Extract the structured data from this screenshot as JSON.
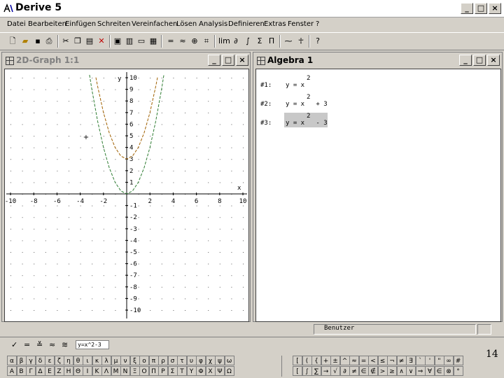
{
  "window": {
    "title": "Derive 5"
  },
  "menu": [
    "Datei",
    "Bearbeiten",
    "Einfügen",
    "Schreiten",
    "Vereinfachen",
    "Lösen",
    "Analysis",
    "Definieren",
    "Extras",
    "Fenster",
    "?"
  ],
  "graph_window": {
    "title": "2D-Graph 1:1",
    "y_label": "y",
    "x_label": "x",
    "x_ticks": [
      "-10",
      "-8",
      "-6",
      "-4",
      "-2",
      "2",
      "4",
      "6",
      "8",
      "10"
    ],
    "y_ticks": [
      "10",
      "9",
      "8",
      "7",
      "6",
      "5",
      "4",
      "3",
      "2",
      "1",
      "-1",
      "-2",
      "-3",
      "-4",
      "-5",
      "-6",
      "-7",
      "-8",
      "-9",
      "-10"
    ],
    "cross_marker": "+",
    "chart_data": {
      "type": "line",
      "xlim": [
        -10,
        10
      ],
      "ylim": [
        -10,
        10
      ],
      "grid": "dots",
      "series": [
        {
          "x": [
            -3.2,
            -3,
            -2.5,
            -2,
            -1.5,
            -1,
            -0.5,
            0,
            0.5,
            1,
            1.5,
            2,
            2.5,
            3,
            3.2
          ],
          "y": [
            10.24,
            9,
            6.25,
            4,
            2.25,
            1,
            0.25,
            0,
            0.25,
            1,
            2.25,
            4,
            6.25,
            9,
            10.24
          ],
          "color": "#2e7d32"
        },
        {
          "x": [
            -2.65,
            -2.5,
            -2,
            -1.5,
            -1,
            -0.5,
            0,
            0.5,
            1,
            1.5,
            2,
            2.5,
            2.65
          ],
          "y": [
            10.02,
            9.25,
            7,
            5.25,
            4,
            3.25,
            3,
            3.25,
            4,
            5.25,
            7,
            9.25,
            10.02
          ],
          "color": "#a06000"
        }
      ]
    }
  },
  "algebra_window": {
    "title": "Algebra 1",
    "expressions": [
      {
        "label": "#1:",
        "text": "y = x",
        "exp": "2",
        "tail": ""
      },
      {
        "label": "#2:",
        "text": "y = x",
        "exp": "2",
        "tail": " + 3"
      },
      {
        "label": "#3:",
        "text": "y = x",
        "exp": "2",
        "tail": " - 3"
      }
    ]
  },
  "status": {
    "text": "Benutzer"
  },
  "entry": {
    "value": "y=x^2-3"
  },
  "greek_lower": [
    "α",
    "β",
    "γ",
    "δ",
    "ε",
    "ζ",
    "η",
    "θ",
    "ι",
    "κ",
    "λ",
    "μ",
    "ν",
    "ξ",
    "ο",
    "π",
    "ρ",
    "σ",
    "τ",
    "υ",
    "φ",
    "χ",
    "ψ",
    "ω"
  ],
  "greek_upper": [
    "Α",
    "Β",
    "Γ",
    "Δ",
    "Ε",
    "Ζ",
    "Η",
    "Θ",
    "Ι",
    "Κ",
    "Λ",
    "Μ",
    "Ν",
    "Ξ",
    "Ο",
    "Π",
    "Ρ",
    "Σ",
    "Τ",
    "Υ",
    "Φ",
    "Χ",
    "Ψ",
    "Ω"
  ],
  "math_row1": [
    "[",
    "(",
    "{",
    "+",
    "±",
    "^",
    "≈",
    "=",
    "<",
    "≤",
    "¬",
    "≠",
    "∃",
    "`",
    "'",
    "\"",
    "∞",
    "#"
  ],
  "math_row2": [
    "[",
    "∫",
    "∑",
    "→",
    "√",
    "∂",
    "≠",
    "∈",
    "∉",
    ">",
    "≥",
    "∧",
    "∨",
    "⇒",
    "∀",
    "∈",
    "⊗",
    "°"
  ],
  "page_number": "14"
}
